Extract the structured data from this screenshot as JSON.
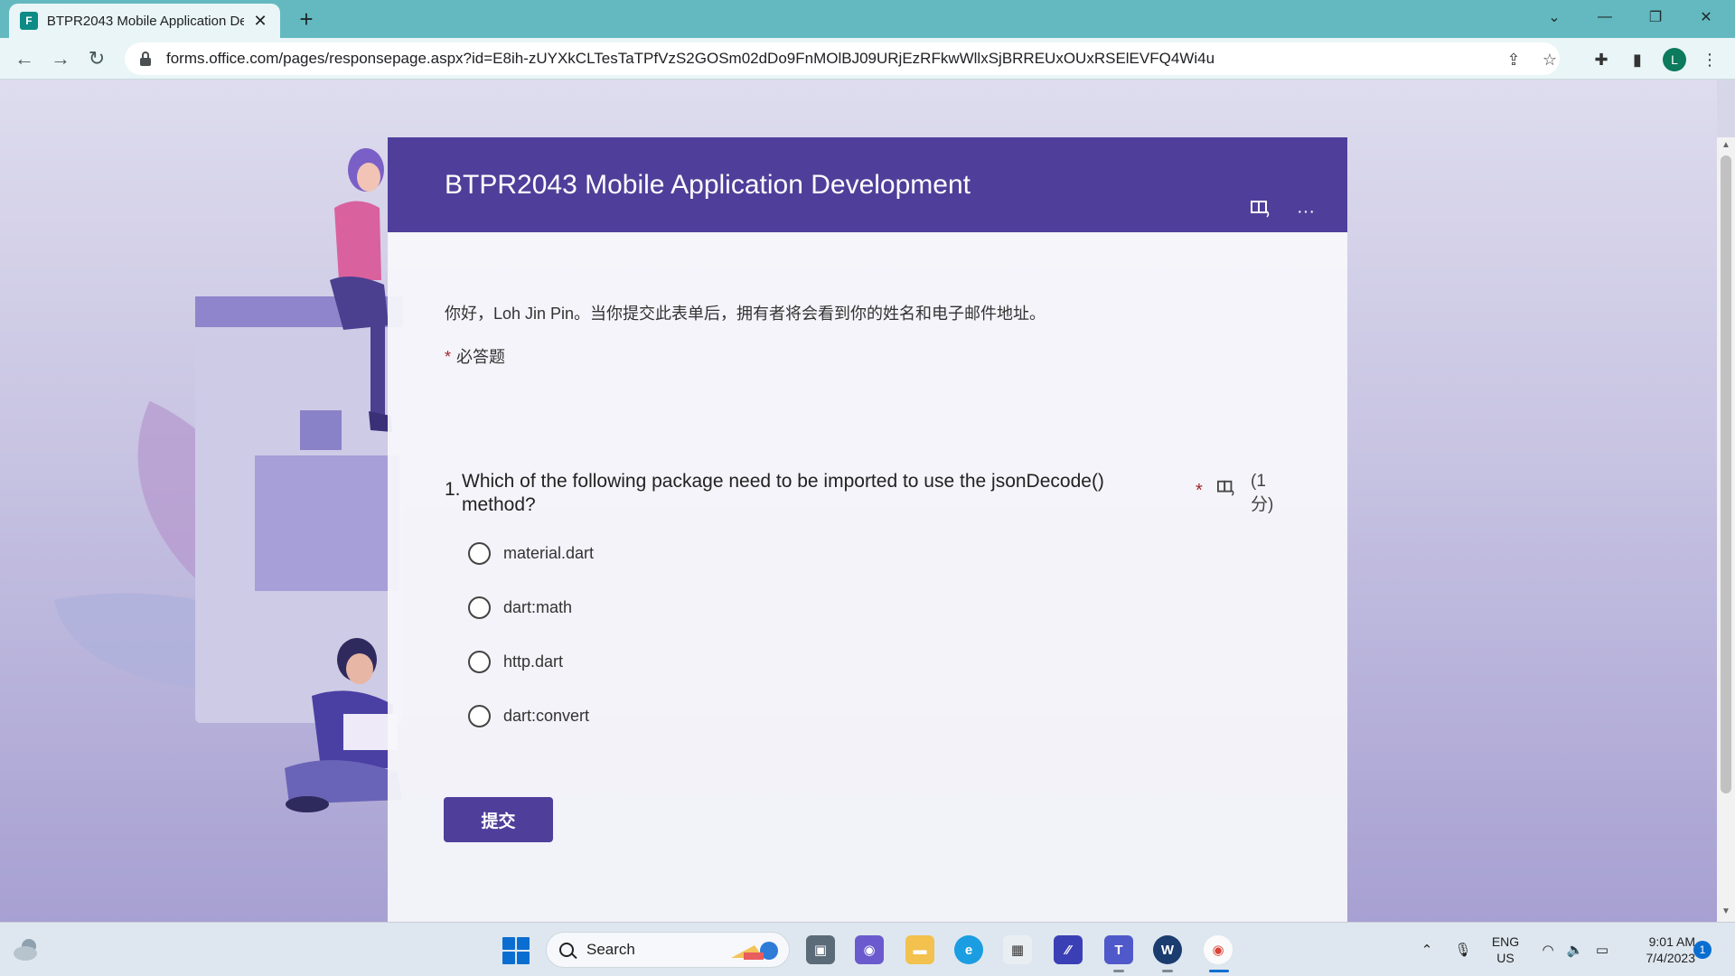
{
  "browser": {
    "tab_title": "BTPR2043 Mobile Application Development",
    "tab_favicon": "forms-icon",
    "url": "forms.office.com/pages/responsepage.aspx?id=E8ih-zUYXkCLTesTaTPfVzS2GOSm02dDo9FnMOlBJ09URjEzRFkwWllxSjBRREUxOUxRSElEVFQ4Wi4u",
    "profile_initial": "L"
  },
  "form": {
    "title": "BTPR2043 Mobile Application Development",
    "greeting": "你好，Loh Jin Pin。当你提交此表单后，拥有者将会看到你的姓名和电子邮件地址。",
    "required_star": "*",
    "required_note": "必答题",
    "question": {
      "number": "1.",
      "text": "Which of the following package need to be imported to use the jsonDecode() method?",
      "required_star": "*",
      "points": "(1 分)",
      "options": [
        "material.dart",
        "dart:math",
        "http.dart",
        "dart:convert"
      ]
    },
    "submit_label": "提交"
  },
  "taskbar": {
    "search_label": "Search",
    "language_line1": "ENG",
    "language_line2": "US",
    "time": "9:01 AM",
    "date": "7/4/2023",
    "notification_count": "1"
  },
  "colors": {
    "form_header": "#4f3f9a",
    "tabbar": "#63b9bf",
    "required": "#a4262c"
  }
}
